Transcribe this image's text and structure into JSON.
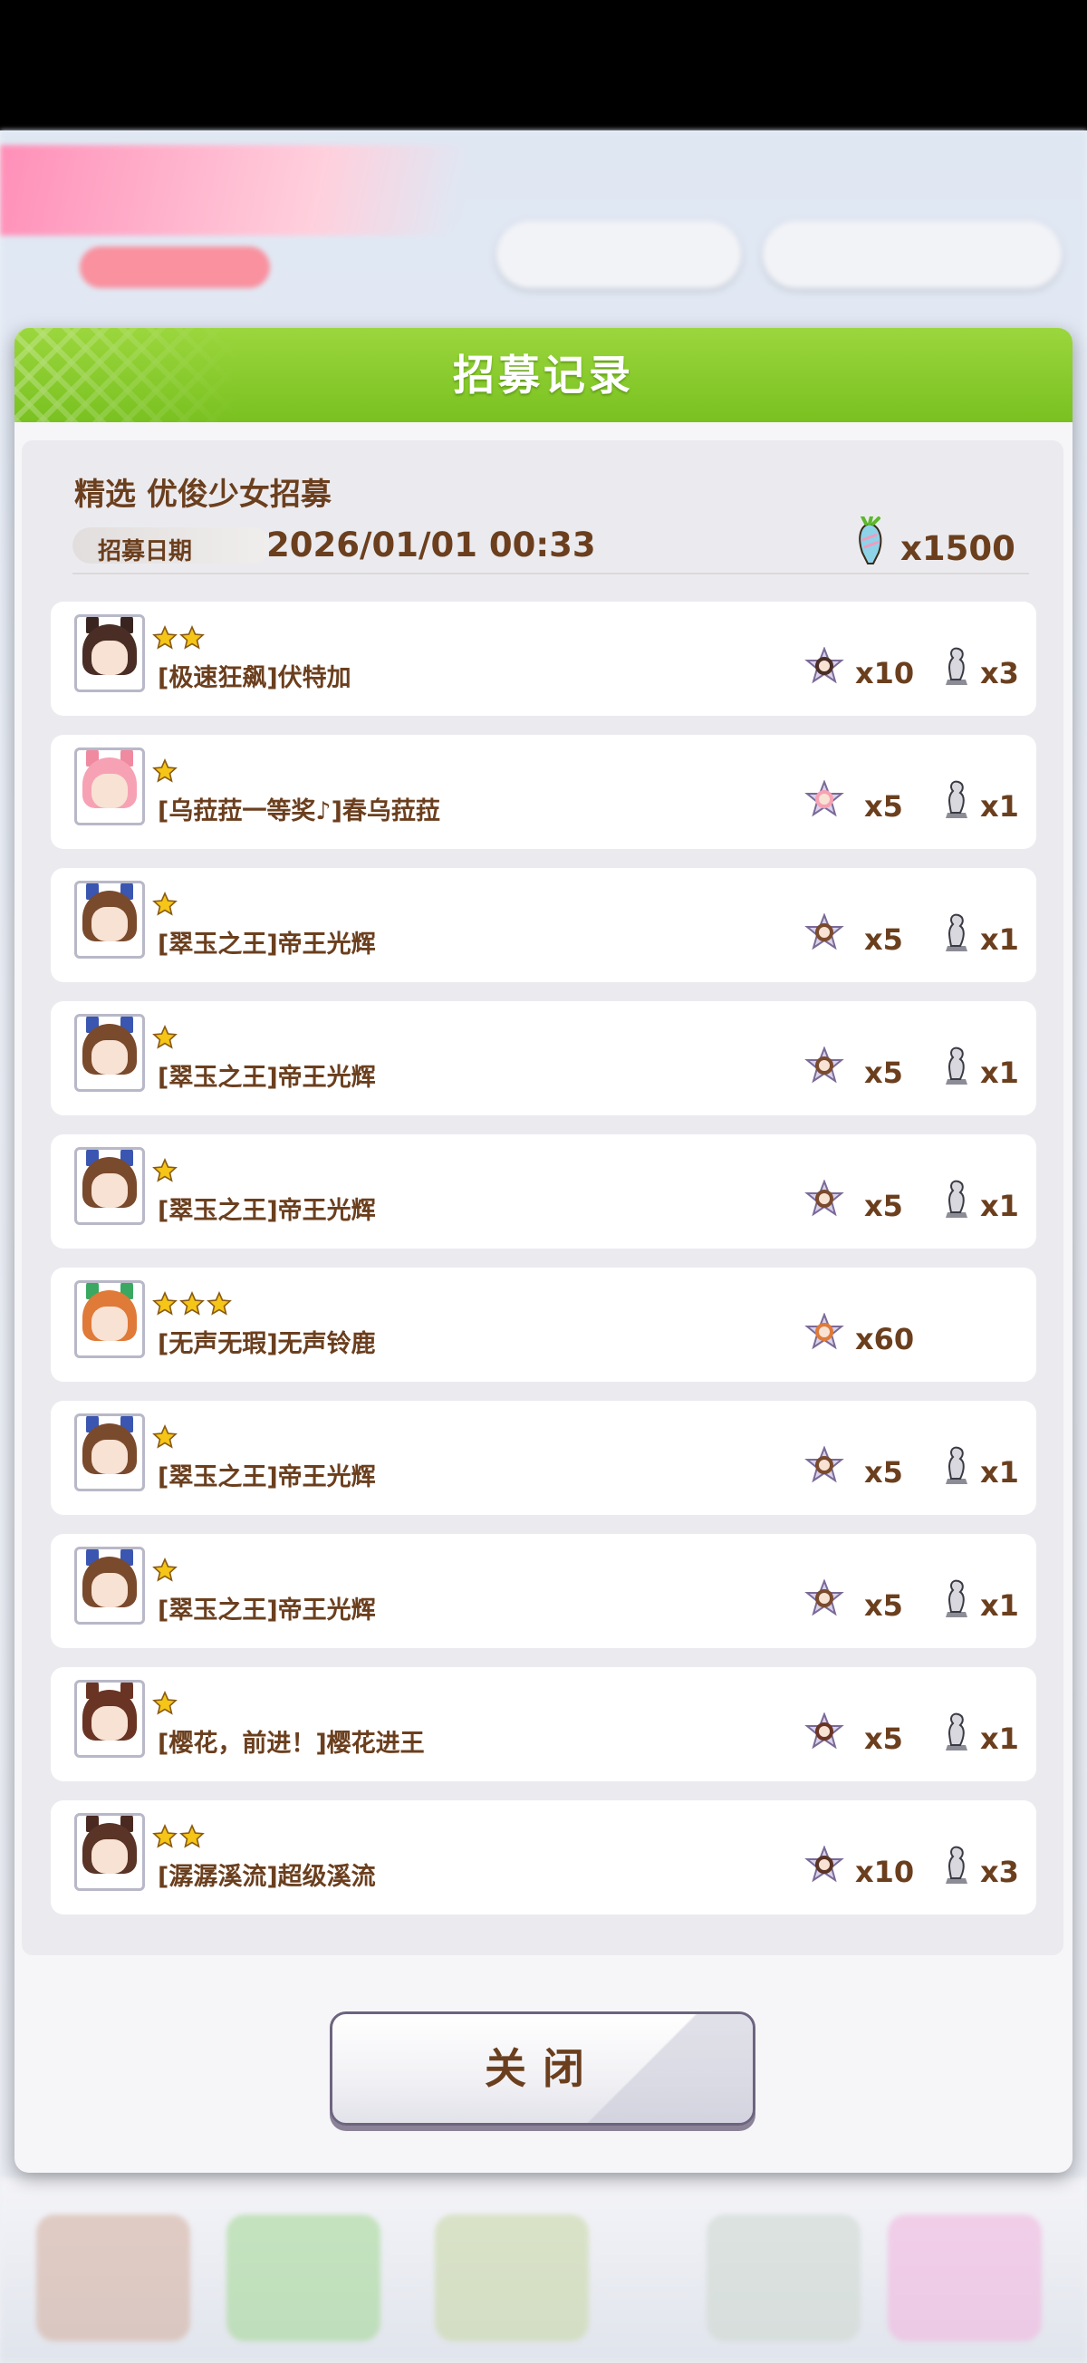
{
  "dialog": {
    "title": "招募记录",
    "banner_name": "精选  优俊少女招募",
    "date_label": "招募日期",
    "date_value": "2026/01/01  00:33",
    "cost": "x1500",
    "close_label": "关闭"
  },
  "records": [
    {
      "stars": 2,
      "name": "[极速狂飙]伏特加",
      "pieces": "x10",
      "trophies": "x3",
      "hair": "#4a2e26",
      "ear": "#3a2420"
    },
    {
      "stars": 1,
      "name": "[乌菈菈一等奖♪]春乌菈菈",
      "pieces": "x5",
      "trophies": "x1",
      "hair": "#f6a2b4",
      "ear": "#f08aa0"
    },
    {
      "stars": 1,
      "name": "[翠玉之王]帝王光辉",
      "pieces": "x5",
      "trophies": "x1",
      "hair": "#7a4a2c",
      "ear": "#3a56b0"
    },
    {
      "stars": 1,
      "name": "[翠玉之王]帝王光辉",
      "pieces": "x5",
      "trophies": "x1",
      "hair": "#7a4a2c",
      "ear": "#3a56b0"
    },
    {
      "stars": 1,
      "name": "[翠玉之王]帝王光辉",
      "pieces": "x5",
      "trophies": "x1",
      "hair": "#7a4a2c",
      "ear": "#3a56b0"
    },
    {
      "stars": 3,
      "name": "[无声无瑕]无声铃鹿",
      "pieces": "x60",
      "trophies": "",
      "hair": "#e07a38",
      "ear": "#3aa860"
    },
    {
      "stars": 1,
      "name": "[翠玉之王]帝王光辉",
      "pieces": "x5",
      "trophies": "x1",
      "hair": "#7a4a2c",
      "ear": "#3a56b0"
    },
    {
      "stars": 1,
      "name": "[翠玉之王]帝王光辉",
      "pieces": "x5",
      "trophies": "x1",
      "hair": "#7a4a2c",
      "ear": "#3a56b0"
    },
    {
      "stars": 1,
      "name": "[樱花，前进！]樱花进王",
      "pieces": "x5",
      "trophies": "x1",
      "hair": "#6a3424",
      "ear": "#6a3424"
    },
    {
      "stars": 2,
      "name": "[潺潺溪流]超级溪流",
      "pieces": "x10",
      "trophies": "x3",
      "hair": "#5a3426",
      "ear": "#4a2a20"
    }
  ],
  "colors": {
    "header_green": "#79c120",
    "text_brown": "#6b3f1e",
    "star_gold": "#f5c518"
  },
  "icons": {
    "cost": "carrot-gem-icon",
    "piece": "character-piece-icon",
    "trophy": "trophy-statue-icon",
    "star": "star-icon"
  }
}
